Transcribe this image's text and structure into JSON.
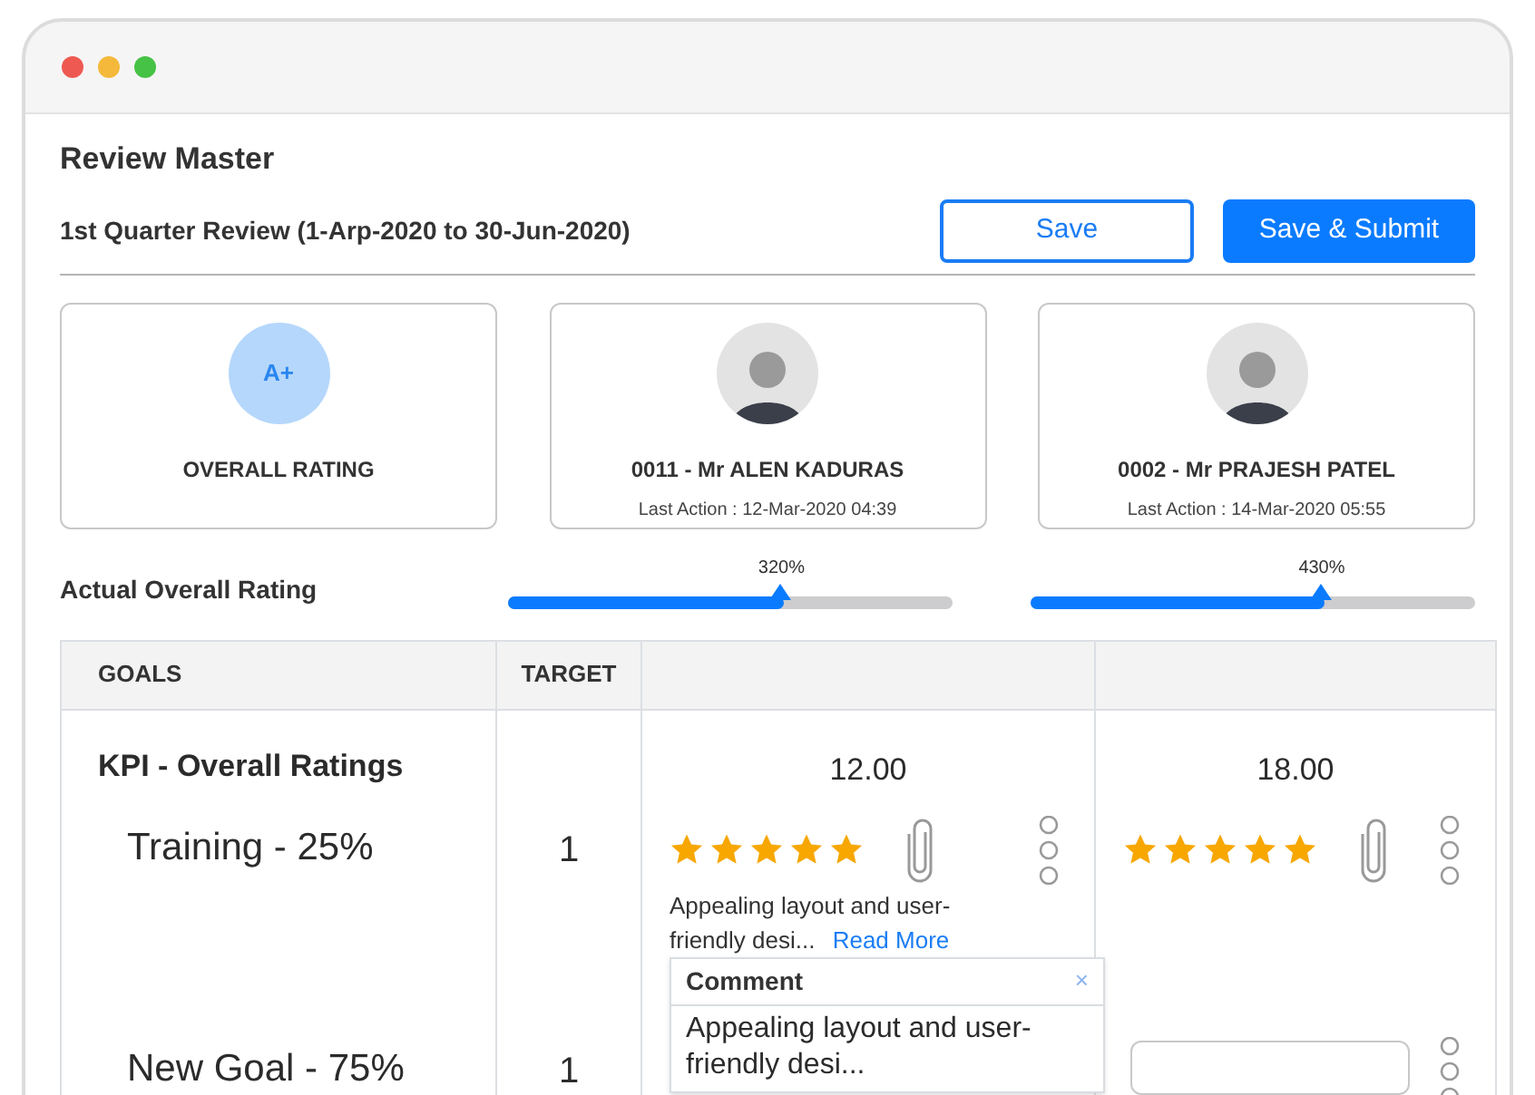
{
  "window": {
    "title": "Review Master"
  },
  "review": {
    "period": "1st Quarter Review (1-Arp-2020 to 30-Jun-2020)",
    "buttons": [
      {
        "label": "Save",
        "kind": "outline"
      },
      {
        "label": "Save & Submit",
        "kind": "primary"
      }
    ]
  },
  "cards": [
    {
      "kind": "grade",
      "badge": "A+",
      "title": "OVERALL RATING"
    },
    {
      "kind": "person",
      "title": "0011 - Mr ALEN KADURAS",
      "subtitle": "Last Action : 12-Mar-2020 04:39"
    },
    {
      "kind": "person",
      "title": "0002 - Mr PRAJESH PATEL",
      "subtitle": "Last Action : 14-Mar-2020 05:55"
    }
  ],
  "overall": {
    "label": "Actual Overall Rating",
    "bars": [
      {
        "reading": "320%",
        "level": 0.62
      },
      {
        "reading": "430%",
        "level": 0.66
      }
    ]
  },
  "table": {
    "columns": [
      "GOALS",
      "TARGET"
    ],
    "kpi": {
      "title": "KPI - Overall Ratings",
      "scores": [
        "12.00",
        "18.00"
      ]
    },
    "rows": [
      {
        "goal": "Training - 25%",
        "target": "1",
        "reviews": [
          {
            "kind": "rated",
            "stars": 5,
            "comment": "Appealing layout and user-friendly desi...",
            "link": "Read More"
          },
          {
            "kind": "rated",
            "stars": 5
          }
        ]
      },
      {
        "goal": "New Goal - 75%",
        "target": "1",
        "reviews": [
          {
            "kind": "popup",
            "title": "Comment",
            "close": "×",
            "text": "Appealing layout and user-friendly desi..."
          },
          {
            "kind": "input"
          }
        ]
      }
    ]
  }
}
